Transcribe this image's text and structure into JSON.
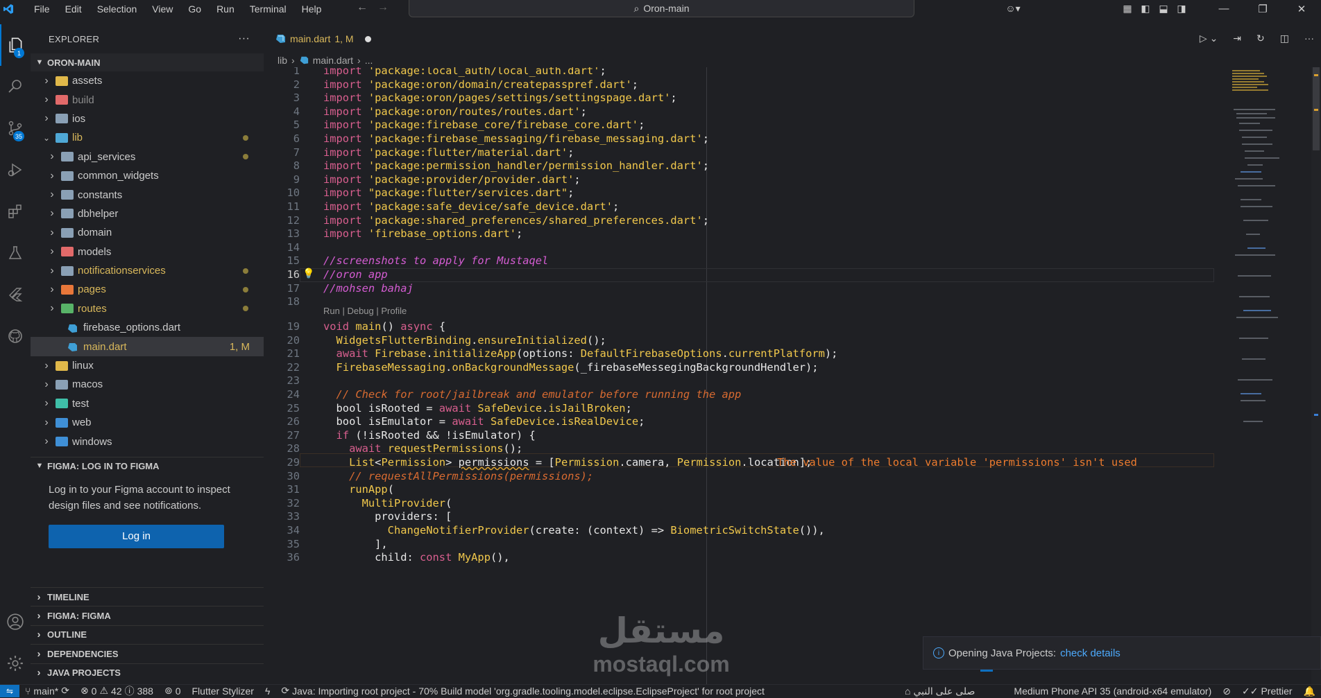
{
  "titlebar": {
    "menu": [
      "File",
      "Edit",
      "Selection",
      "View",
      "Go",
      "Run",
      "Terminal",
      "Help"
    ],
    "search_text": "Oron-main"
  },
  "activity": {
    "explorer_badge": "1",
    "scm_badge": "35"
  },
  "sidebar": {
    "title": "EXPLORER",
    "more": "···",
    "root": "ORON-MAIN",
    "tree": [
      {
        "label": "assets",
        "depth": 0,
        "color": "#cccccc",
        "folder": "#e0b84a"
      },
      {
        "label": "build",
        "depth": 0,
        "color": "#8b8b8b",
        "folder": "#e26a6a"
      },
      {
        "label": "ios",
        "depth": 0,
        "color": "#cccccc",
        "folder": "#8aa0b5"
      },
      {
        "label": "lib",
        "depth": 0,
        "color": "#d9b85b",
        "folder": "#4fa8d6",
        "open": true,
        "dot": true
      },
      {
        "label": "api_services",
        "depth": 1,
        "color": "#cccccc",
        "folder": "#8aa0b5",
        "dot": true
      },
      {
        "label": "common_widgets",
        "depth": 1,
        "color": "#cccccc",
        "folder": "#8aa0b5"
      },
      {
        "label": "constants",
        "depth": 1,
        "color": "#cccccc",
        "folder": "#8aa0b5"
      },
      {
        "label": "dbhelper",
        "depth": 1,
        "color": "#cccccc",
        "folder": "#8aa0b5"
      },
      {
        "label": "domain",
        "depth": 1,
        "color": "#cccccc",
        "folder": "#8aa0b5"
      },
      {
        "label": "models",
        "depth": 1,
        "color": "#cccccc",
        "folder": "#e26a6a"
      },
      {
        "label": "notificationservices",
        "depth": 1,
        "color": "#d9b85b",
        "folder": "#8aa0b5",
        "dot": true
      },
      {
        "label": "pages",
        "depth": 1,
        "color": "#d9b85b",
        "folder": "#e8773a",
        "dot": true
      },
      {
        "label": "routes",
        "depth": 1,
        "color": "#d9b85b",
        "folder": "#58b368",
        "dot": true
      },
      {
        "label": "firebase_options.dart",
        "depth": 2,
        "color": "#cccccc",
        "file": "#3f9fd6"
      },
      {
        "label": "main.dart",
        "depth": 2,
        "color": "#d9b85b",
        "file": "#3f9fd6",
        "selected": true,
        "stat": "1, M"
      },
      {
        "label": "linux",
        "depth": 0,
        "color": "#cccccc",
        "folder": "#e0b84a"
      },
      {
        "label": "macos",
        "depth": 0,
        "color": "#cccccc",
        "folder": "#8aa0b5"
      },
      {
        "label": "test",
        "depth": 0,
        "color": "#cccccc",
        "folder": "#3fbfa8"
      },
      {
        "label": "web",
        "depth": 0,
        "color": "#cccccc",
        "folder": "#3f8fd6"
      },
      {
        "label": "windows",
        "depth": 0,
        "color": "#cccccc",
        "folder": "#3f8fd6"
      }
    ],
    "figma": {
      "header": "FIGMA: LOG IN TO FIGMA",
      "message": "Log in to your Figma account to inspect design files and see notifications.",
      "button": "Log in"
    },
    "sections": [
      "TIMELINE",
      "FIGMA: FIGMA",
      "OUTLINE",
      "DEPENDENCIES",
      "JAVA PROJECTS"
    ]
  },
  "editor": {
    "tab_label": "main.dart",
    "tab_status": "1, M",
    "breadcrumb": [
      "lib",
      "main.dart",
      "..."
    ],
    "codelens": "Run | Debug | Profile",
    "problem": "The value of the local variable 'permissions' isn't used"
  },
  "notification": {
    "text": "Opening Java Projects:",
    "link": "check details"
  },
  "watermark": {
    "arabic": "مستقل",
    "latin": "mostaql.com"
  },
  "statusbar": {
    "branch": "main*",
    "errors": "0",
    "warnings": "42",
    "info": "388",
    "ports": "0",
    "stylizer": "Flutter Stylizer",
    "task": "Java: Importing root project - 70% Build model 'org.gradle.tooling.model.eclipse.EclipseProject' for root project",
    "arabic": "صلى على النبي",
    "device": "Medium Phone API 35 (android-x64 emulator)",
    "prettier": "Prettier"
  }
}
